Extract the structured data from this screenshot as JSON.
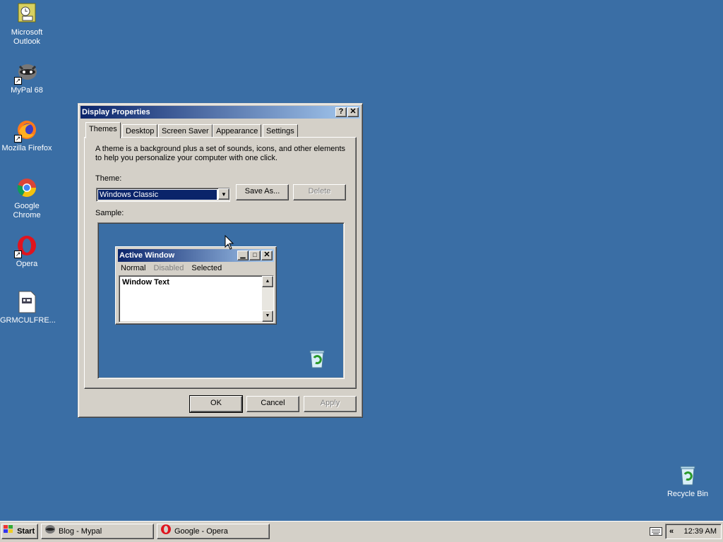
{
  "desktop": {
    "icons": [
      {
        "label": "Microsoft Outlook",
        "icon": "outlook-icon"
      },
      {
        "label": "MyPal 68",
        "icon": "mypal-icon"
      },
      {
        "label": "Mozilla Firefox",
        "icon": "firefox-icon"
      },
      {
        "label": "Google Chrome",
        "icon": "chrome-icon"
      },
      {
        "label": "Opera",
        "icon": "opera-icon"
      },
      {
        "label": "GRMCULFRE...",
        "icon": "file-icon"
      },
      {
        "label": "Recycle Bin",
        "icon": "recycle-bin-icon"
      }
    ],
    "background_color": "#3a6ea5"
  },
  "dialog": {
    "title": "Display Properties",
    "help_glyph": "?",
    "close_glyph": "✕",
    "tabs": [
      "Themes",
      "Desktop",
      "Screen Saver",
      "Appearance",
      "Settings"
    ],
    "active_tab": "Themes",
    "description": "A theme is a background plus a set of sounds, icons, and other elements to help you personalize your computer with one click.",
    "theme_label": "Theme:",
    "theme_value": "Windows Classic",
    "save_as_label": "Save As...",
    "delete_label": "Delete",
    "sample_label": "Sample:",
    "sample": {
      "window_title": "Active Window",
      "menu": [
        "Normal",
        "Disabled",
        "Selected"
      ],
      "window_text": "Window Text"
    },
    "ok_label": "OK",
    "cancel_label": "Cancel",
    "apply_label": "Apply"
  },
  "taskbar": {
    "start_label": "Start",
    "tasks": [
      {
        "label": "Blog - Mypal",
        "icon": "mypal-icon"
      },
      {
        "label": "Google - Opera",
        "icon": "opera-icon"
      }
    ],
    "collapse_glyph": "«",
    "clock": "12:39 AM"
  }
}
